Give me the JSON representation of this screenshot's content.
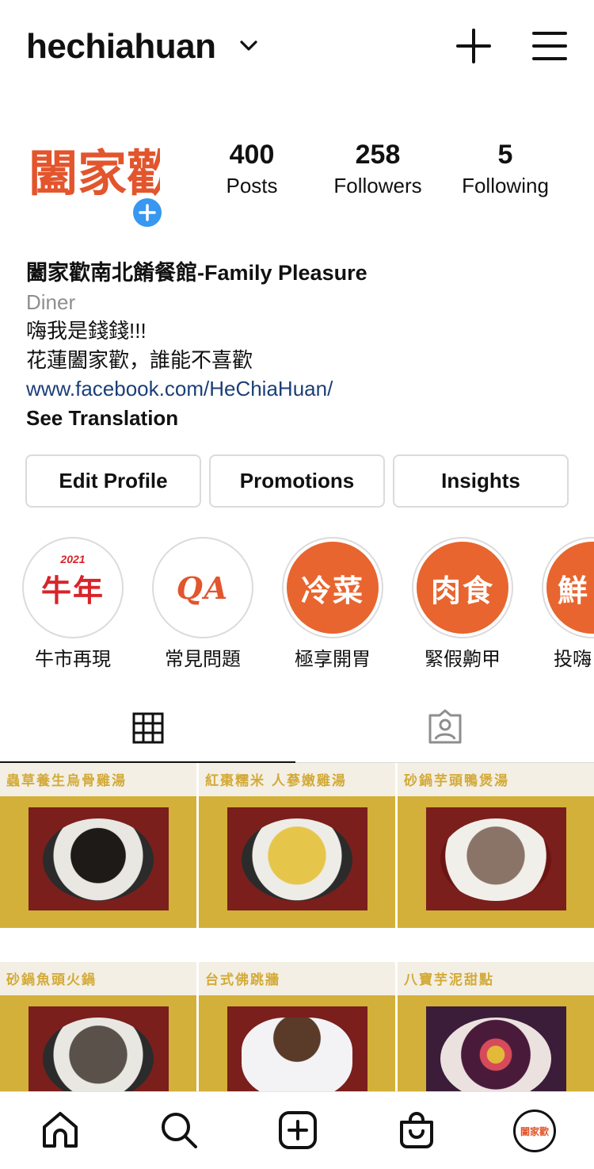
{
  "header": {
    "username": "hechiahuan",
    "icons": [
      "chevron-down-icon",
      "plus-icon",
      "menu-icon"
    ]
  },
  "profile": {
    "avatar_text": "闔家歡",
    "stats": {
      "posts": {
        "value": "400",
        "label": "Posts"
      },
      "followers": {
        "value": "258",
        "label": "Followers"
      },
      "following": {
        "value": "5",
        "label": "Following"
      }
    },
    "name": "闔家歡南北餚餐館-Family Pleasure",
    "category": "Diner",
    "bio_line1": "嗨我是錢錢!!!",
    "bio_line2": "花蓮闔家歡，誰能不喜歡",
    "link": "www.facebook.com/HeChiaHuan/",
    "see_translation": "See Translation"
  },
  "buttons": {
    "edit": "Edit Profile",
    "promotions": "Promotions",
    "insights": "Insights"
  },
  "highlights": [
    {
      "title": "牛市再現",
      "cover": "牛年",
      "year": "2021"
    },
    {
      "title": "常見問題",
      "cover": "QA"
    },
    {
      "title": "極享開胃",
      "cover": "冷菜"
    },
    {
      "title": "緊假齁甲",
      "cover": "肉食"
    },
    {
      "title": "投嗨",
      "cover": "鮮"
    }
  ],
  "tabs": {
    "grid": "grid-icon",
    "tagged": "tagged-icon"
  },
  "posts": [
    {
      "caption": "蟲草養生烏骨雞湯"
    },
    {
      "caption": "紅棗糯米 人蔘嫩雞湯"
    },
    {
      "caption": "砂鍋芋頭鴨煲湯"
    },
    {
      "caption": "砂鍋魚頭火鍋"
    },
    {
      "caption": "台式佛跳牆"
    },
    {
      "caption": "八寶芋泥甜點"
    }
  ],
  "bottom_nav": {
    "items": [
      "home-icon",
      "search-icon",
      "new-post-icon",
      "shop-icon",
      "profile-avatar"
    ],
    "avatar_text": "闔家歡"
  },
  "colors": {
    "accent_blue": "#3897f0",
    "link_blue": "#1b3f77",
    "brand_orange": "#e2552d",
    "gold": "#d3b039"
  }
}
